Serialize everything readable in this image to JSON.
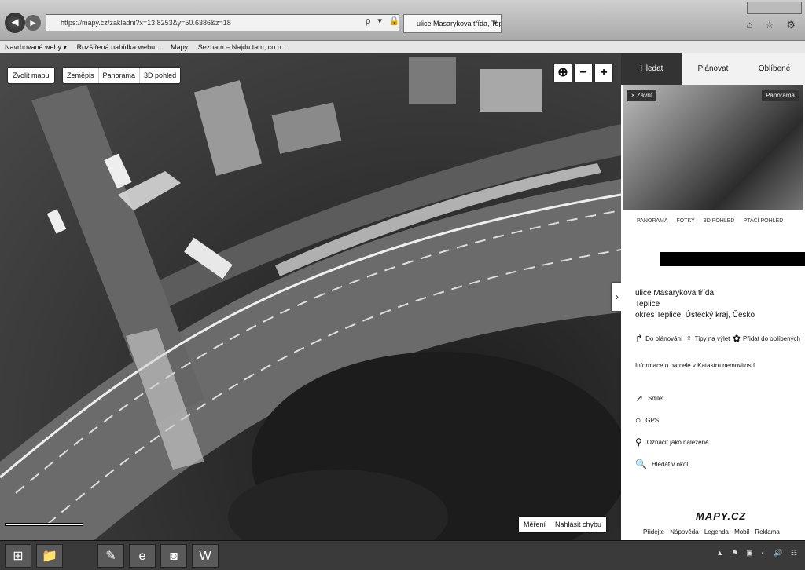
{
  "browser": {
    "url": "https://mapy.cz/zakladni?x=13.8253&y=50.6386&z=18",
    "tab_title": "ulice Masarykova třída, Tep...",
    "tab_close": "×",
    "addr_icons": "ρ ▾ 🔒 ↻",
    "back_icon": "◄",
    "forward_icon": "►",
    "right_icons": "⌂ ☆ ⚙",
    "bookmarks": [
      "Navrhované weby ▾",
      "Rozšířená nabídka webu...",
      "Mapy",
      "Seznam – Najdu tam, co n..."
    ]
  },
  "map": {
    "choose_map": "Zvolit mapu",
    "views": [
      "Zeměpis",
      "Panorama",
      "3D pohled"
    ],
    "zoom_icons": [
      "⊕",
      "−",
      "+"
    ],
    "measure": "Měření",
    "report": "Nahlásit chybu",
    "panel_toggle": "›"
  },
  "panel": {
    "tabs": [
      "Hledat",
      "Plánovat",
      "Oblíbené"
    ],
    "tab_icons": [
      "search-icon",
      "route-icon",
      "star-icon"
    ],
    "close_label": "× Zavřít",
    "panorama_label": "Panorama",
    "photo_tabs": [
      "PANORAMA",
      "FOTKY",
      "3D POHLED",
      "PTAČÍ POHLED"
    ],
    "address": {
      "line1": "ulice Masarykova třída",
      "line2": "Teplice",
      "line3": "okres Teplice, Ústecký kraj, Česko"
    },
    "actions": [
      {
        "icon": "↱",
        "label": "Do plánování"
      },
      {
        "icon": "♀",
        "label": "Tipy na výlet"
      },
      {
        "icon": "✿",
        "label": "Přidat do oblíbených"
      }
    ],
    "cadastre": "Informace o parcele v Katastru nemovitostí",
    "rows": [
      {
        "icon": "↗",
        "label": "Sdílet"
      },
      {
        "icon": "○",
        "label": "GPS"
      },
      {
        "icon": "⚲",
        "label": "Označit jako nalezené"
      },
      {
        "icon": "🔍",
        "label": "Hledat v okolí"
      }
    ],
    "logo": "MAPY.CZ",
    "footer": "Přidejte · Nápověda · Legenda · Mobil · Reklama"
  },
  "taskbar": {
    "buttons": [
      "⊞",
      "📁",
      "✎",
      "e",
      "◙",
      "W"
    ],
    "tray": "▲ ⚑ ▣ ◐ 🔊 ☷"
  }
}
